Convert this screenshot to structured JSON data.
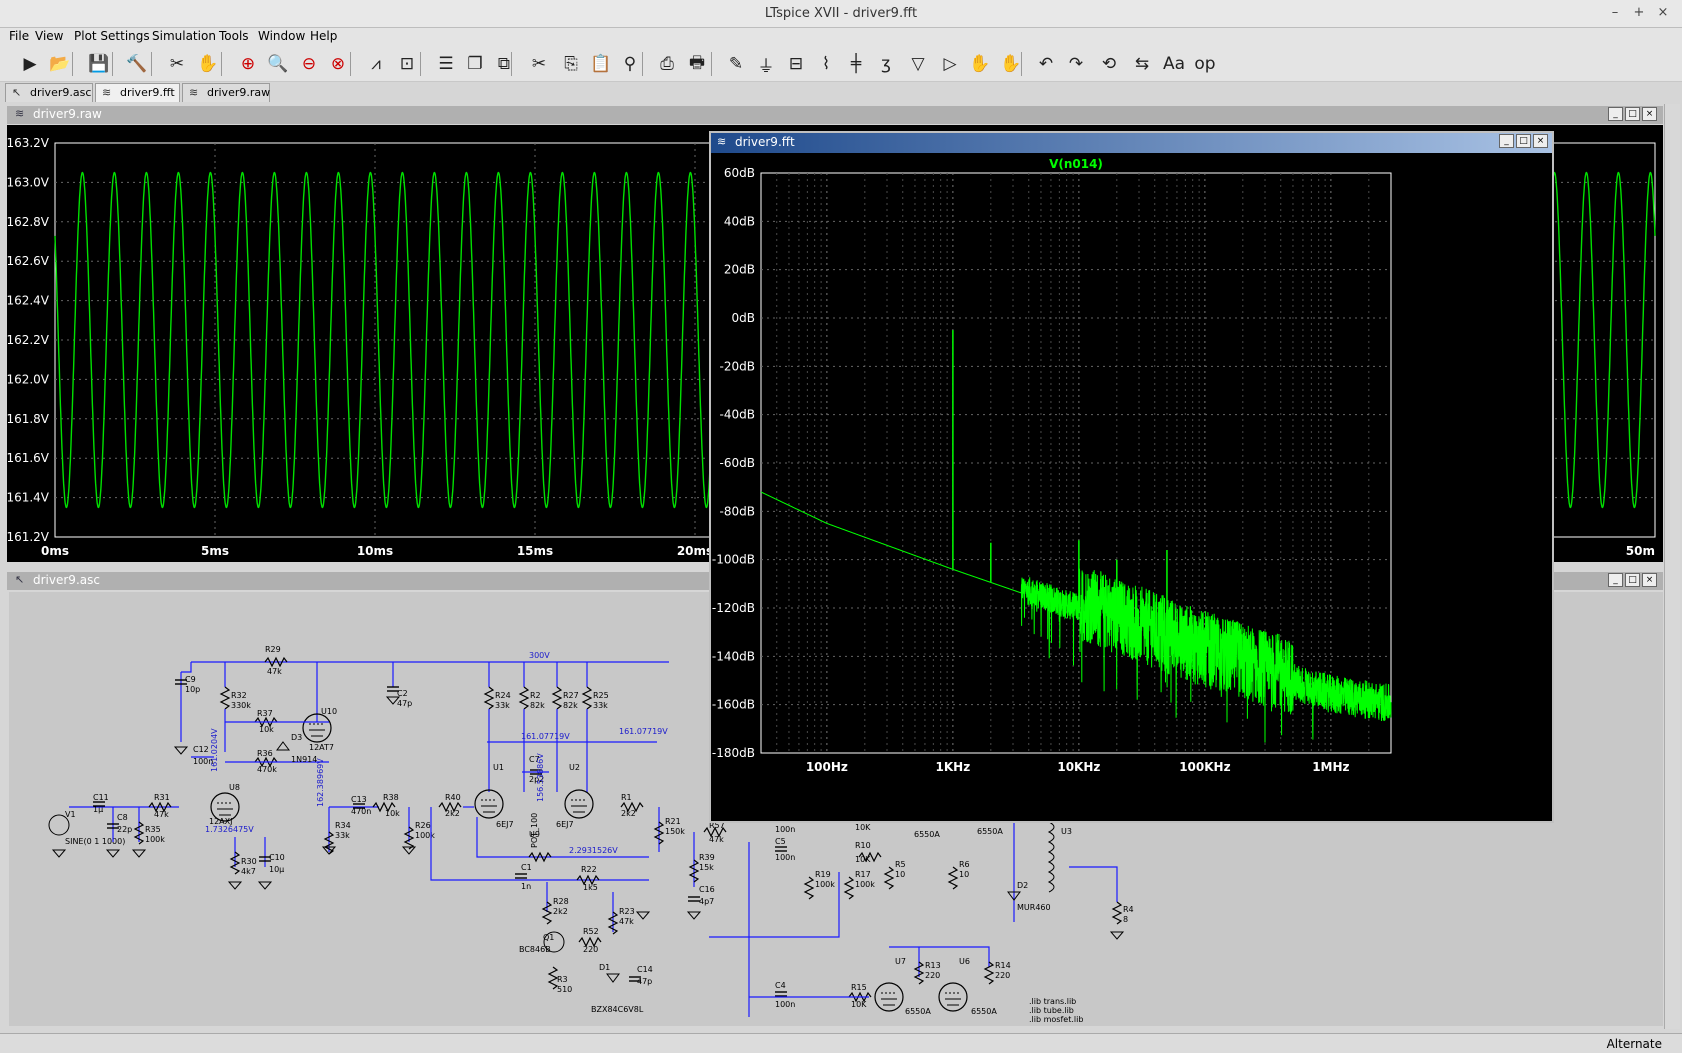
{
  "app": {
    "title": "LTspice XVII - driver9.fft",
    "window_controls": {
      "minimize": "–",
      "maximize": "+",
      "close": "×"
    }
  },
  "menu": [
    "File",
    "View",
    "Plot Settings",
    "Simulation",
    "Tools",
    "Window",
    "Help"
  ],
  "toolbar_icons": [
    "run-icon",
    "open-icon",
    "save-icon",
    "control-panel-icon",
    "probe-icon",
    "pan-icon",
    "zoom-in-icon",
    "zoom-out-icon",
    "zoom-full-icon",
    "zoom-cancel-icon",
    "autorange-icon",
    "pick-visible-icon",
    "tile-vertical-icon",
    "cascade-icon",
    "tile-horizontal-icon",
    "cut-icon",
    "copy-icon",
    "paste-icon",
    "find-icon",
    "print-icon",
    "print-setup-icon",
    "wire-icon",
    "ground-icon",
    "label-icon",
    "resistor-icon",
    "capacitor-icon",
    "inductor-icon",
    "diode-icon",
    "component-icon",
    "move-icon",
    "drag-icon",
    "undo-icon",
    "redo-icon",
    "rotate-icon",
    "mirror-icon",
    "text-icon",
    "spice-directive-icon"
  ],
  "tabs": [
    {
      "label": "driver9.asc",
      "icon": "schematic-icon",
      "active": false
    },
    {
      "label": "driver9.fft",
      "icon": "waveform-icon",
      "active": true
    },
    {
      "label": "driver9.raw",
      "icon": "waveform-icon",
      "active": false
    }
  ],
  "wave_window": {
    "title": "driver9.raw",
    "y_ticks": [
      "163.2V",
      "163.0V",
      "162.8V",
      "162.6V",
      "162.4V",
      "162.2V",
      "162.0V",
      "161.8V",
      "161.6V",
      "161.4V",
      "161.2V"
    ],
    "x_ticks": [
      "0ms",
      "5ms",
      "10ms",
      "15ms",
      "20ms",
      "50m"
    ],
    "trace_color": "#00e000"
  },
  "schematic_window": {
    "title": "driver9.asc",
    "labels": [
      "R29",
      "47k",
      "C9",
      "10p",
      "C2",
      "47p",
      "300V",
      "R32",
      "330k",
      "U10",
      "R37",
      "10k",
      "D3",
      "1N914",
      "12AT7",
      "R24",
      "33k",
      "R2",
      "82k",
      "R27",
      "82k",
      "R25",
      "33k",
      "161.07719V",
      "C12",
      "100n",
      "R36",
      "470k",
      "161.0204V",
      "U8",
      "12AX7",
      "C11",
      "1µ",
      "C8",
      "22p",
      "R31",
      "47k",
      "R35",
      "100k",
      "V1",
      "SINE(0 1 1000)",
      "1.7326475V",
      "R30",
      "4k7",
      "C10",
      "10µ",
      "C13",
      "470n",
      "R38",
      "10k",
      "R34",
      "33k",
      "R26",
      "100k",
      "R40",
      "2k2",
      "U1",
      "6EJ7",
      "C7",
      "2p2",
      "U2",
      "6EJ7",
      "R1",
      "2k2",
      "U9",
      "POT_100",
      "2.2931526V",
      "C1",
      "1n",
      "R22",
      "1k5",
      "R28",
      "2k2",
      "Q1",
      "BC846B",
      "R52",
      "220",
      "R23",
      "47k",
      "R3",
      "510",
      "D1",
      "C14",
      "47p",
      "BZX84C6V8L",
      "R21",
      "150k",
      "R57",
      "47k",
      "R39",
      "15k",
      "C16",
      "4p7",
      "C5",
      "100n",
      "R19",
      "100k",
      "R10",
      "10K",
      "R17",
      "100k",
      "R5",
      "10",
      "R6",
      "10",
      "6550A",
      "6550A",
      "D2",
      "MUR460",
      "U3",
      "R4",
      "8",
      "C4",
      "100n",
      "R15",
      "10K",
      "U7",
      "R13",
      "220",
      "U6",
      "R14",
      "220",
      "6550A",
      "6550A",
      ".lib trans.lib",
      ".lib tube.lib",
      ".lib mosfet.lib"
    ]
  },
  "fft_window": {
    "title": "driver9.fft",
    "trace_name": "V(n014)",
    "trace_color": "#00ff00",
    "y_ticks": [
      "60dB",
      "40dB",
      "20dB",
      "0dB",
      "-20dB",
      "-40dB",
      "-60dB",
      "-80dB",
      "-100dB",
      "-120dB",
      "-140dB",
      "-160dB",
      "-180dB"
    ],
    "x_ticks": [
      "100Hz",
      "1KHz",
      "10KHz",
      "100KHz",
      "1MHz"
    ]
  },
  "chart_data": [
    {
      "type": "line",
      "title": "",
      "xlabel": "",
      "ylabel": "",
      "x_unit": "ms",
      "y_unit": "V",
      "xlim": [
        0,
        50
      ],
      "ylim": [
        161.2,
        163.2
      ],
      "series": [
        {
          "name": "",
          "signal": "sine",
          "frequency_hz": 1000,
          "min": 161.35,
          "max": 163.05
        }
      ]
    },
    {
      "type": "line",
      "title": "V(n014)",
      "xlabel": "",
      "ylabel": "",
      "x_scale": "log",
      "xlim": [
        30,
        3000000
      ],
      "ylim": [
        -180,
        60
      ],
      "series": [
        {
          "name": "V(n014)",
          "noise_floor": {
            "x": [
              30,
              100,
              1000,
              10000,
              100000,
              1000000,
              3000000
            ],
            "y": [
              -72,
              -85,
              -104,
              -122,
              -142,
              -158,
              -162
            ]
          },
          "peaks": [
            {
              "x": 1000,
              "y": -5
            },
            {
              "x": 2000,
              "y": -93
            },
            {
              "x": 10000,
              "y": -92
            },
            {
              "x": 20000,
              "y": -100
            },
            {
              "x": 50000,
              "y": -96
            }
          ]
        }
      ]
    }
  ]
}
